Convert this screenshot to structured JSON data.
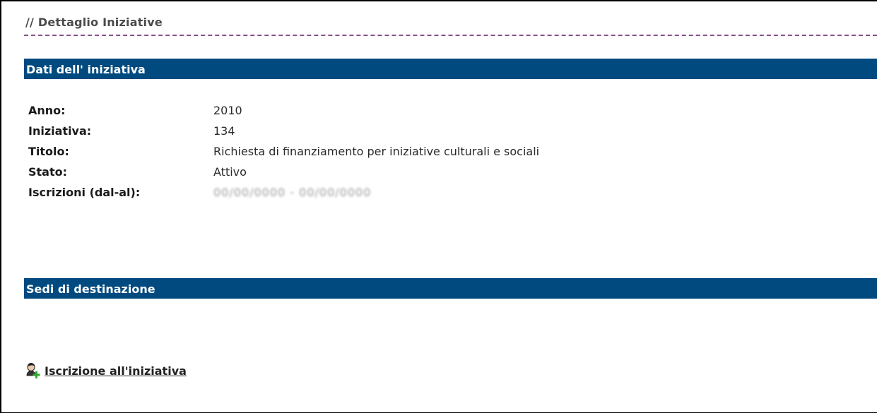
{
  "page": {
    "title": "// Dettaglio Iniziative"
  },
  "sections": {
    "details_title": "Dati dell' iniziativa",
    "destinations_title": "Sedi di destinazione"
  },
  "fields": [
    {
      "label": "Anno:",
      "value": "2010"
    },
    {
      "label": "Iniziativa:",
      "value": "134"
    },
    {
      "label": "Titolo:",
      "value": "Richiesta di finanziamento per iniziative culturali e sociali"
    },
    {
      "label": "Stato:",
      "value": "Attivo"
    },
    {
      "label": "Iscrizioni (dal-al):",
      "value": "00/00/0000 - 00/00/0000"
    }
  ],
  "action": {
    "icon": "user-add-icon",
    "label": "Iscrizione all'iniziativa"
  },
  "colors": {
    "section_bar": "#004a80",
    "header_dash": "#8a4f8a",
    "icon_plus": "#2eaa2e"
  }
}
